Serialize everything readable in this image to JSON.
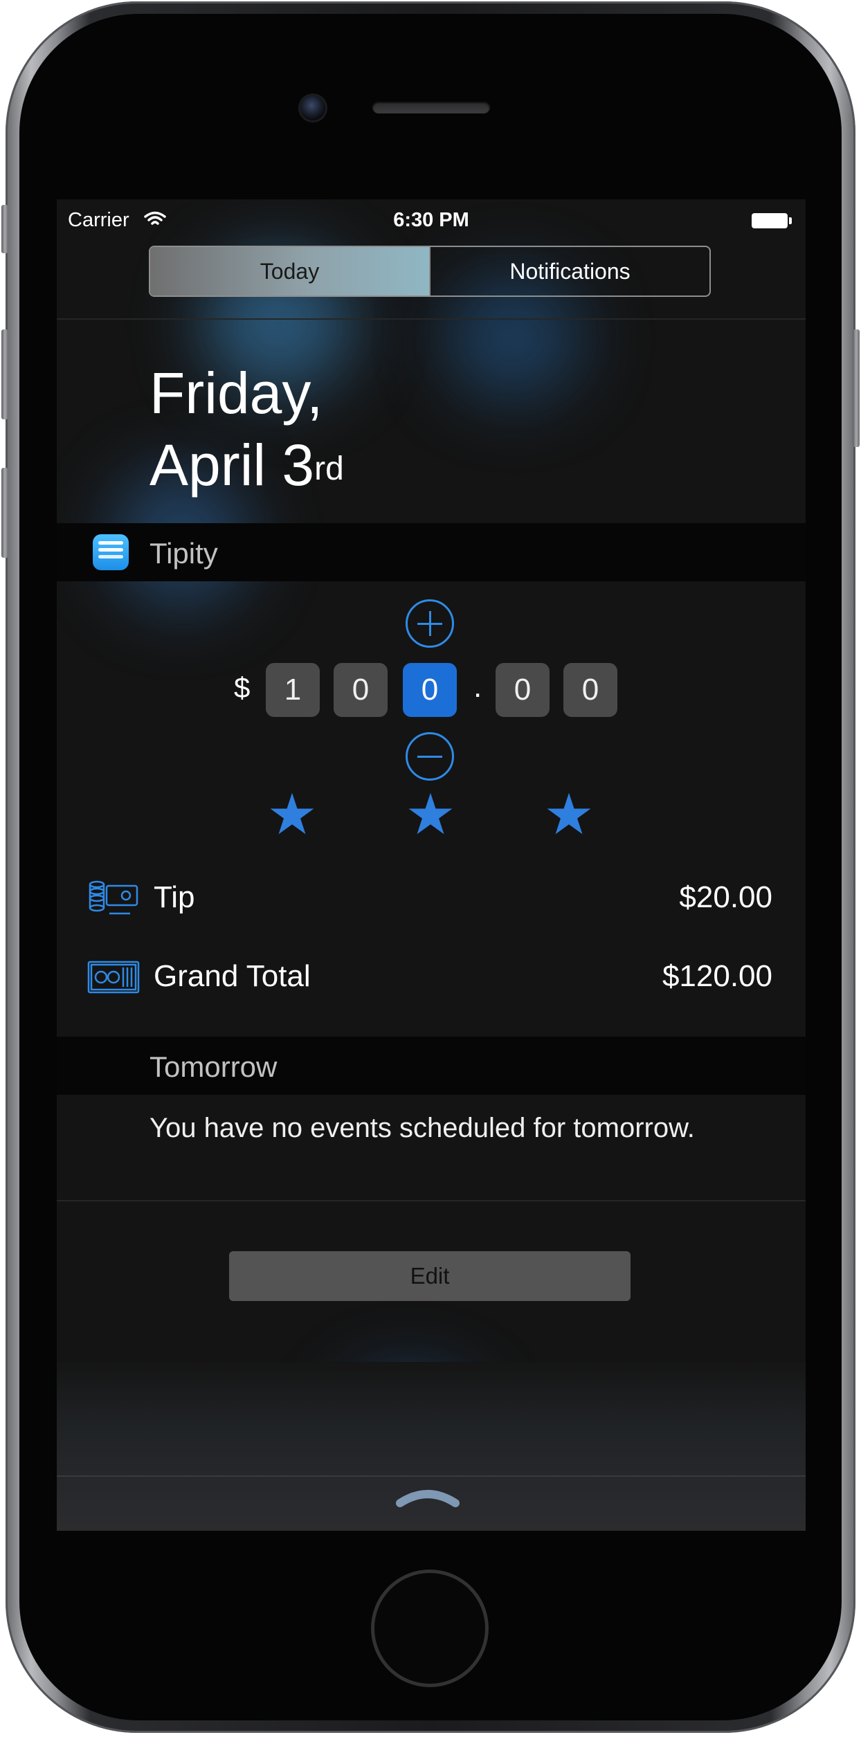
{
  "status_bar": {
    "carrier": "Carrier",
    "time": "6:30 PM"
  },
  "segmented_control": {
    "tabs": [
      {
        "label": "Today",
        "selected": true
      },
      {
        "label": "Notifications",
        "selected": false
      }
    ]
  },
  "date": {
    "weekday": "Friday,",
    "month_day": "April 3",
    "suffix": "rd"
  },
  "widget": {
    "app_name": "Tipity",
    "currency_symbol": "$",
    "digits": [
      "1",
      "0",
      "0",
      "0",
      "0"
    ],
    "selected_digit_index": 2,
    "decimal_separator": ".",
    "rating": {
      "stars": 3,
      "max": 3
    },
    "rows": [
      {
        "label": "Tip",
        "value": "$20.00",
        "icon": "coins-icon"
      },
      {
        "label": "Grand Total",
        "value": "$120.00",
        "icon": "cash-icon"
      }
    ],
    "accent_color": "#2f8ae6"
  },
  "tomorrow": {
    "title": "Tomorrow",
    "message": "You have no events scheduled for tomorrow."
  },
  "edit_button": {
    "label": "Edit"
  }
}
